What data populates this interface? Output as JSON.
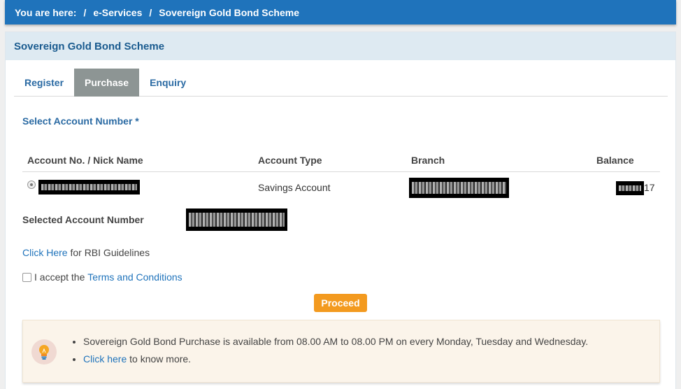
{
  "breadcrumb": {
    "prefix": "You are here:",
    "sep": "/",
    "items": [
      "e-Services",
      "Sovereign Gold Bond Scheme"
    ]
  },
  "panel": {
    "title": "Sovereign Gold Bond Scheme"
  },
  "tabs": [
    {
      "label": "Register",
      "active": false
    },
    {
      "label": "Purchase",
      "active": true
    },
    {
      "label": "Enquiry",
      "active": false
    }
  ],
  "select_account_label": "Select Account Number *",
  "table": {
    "headers": [
      "Account No. / Nick Name",
      "Account Type",
      "Branch",
      "Balance"
    ],
    "rows": [
      {
        "account_type": "Savings Account",
        "balance_suffix": "17",
        "selected": true
      }
    ]
  },
  "selected_account_label": "Selected Account Number",
  "rbi": {
    "link": "Click Here",
    "text": " for RBI Guidelines"
  },
  "terms": {
    "text": "I accept the ",
    "link": "Terms and Conditions",
    "checked": false
  },
  "proceed_label": "Proceed",
  "info": {
    "icon": "lightbulb-icon",
    "line1": "Sovereign Gold Bond Purchase is available from 08.00 AM to 08.00 PM on every Monday, Tuesday and Wednesday.",
    "line2_link": "Click here",
    "line2_text": " to know more."
  },
  "colors": {
    "header_blue": "#1f73bb",
    "accent_orange": "#f39a1f",
    "tab_active": "#8d9594"
  }
}
